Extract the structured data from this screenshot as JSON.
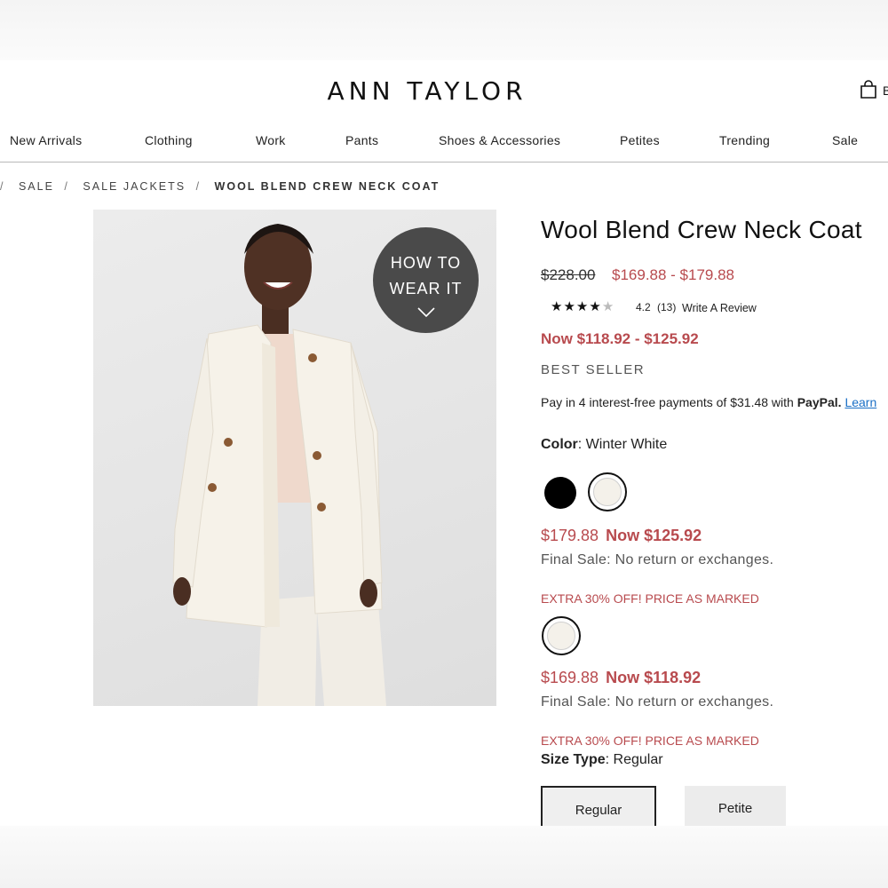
{
  "brand": {
    "logo_text": "ANN TAYLOR",
    "bag_label": "B"
  },
  "nav": {
    "items": [
      {
        "label": "New Arrivals"
      },
      {
        "label": "Clothing"
      },
      {
        "label": "Work"
      },
      {
        "label": "Pants"
      },
      {
        "label": "Shoes & Accessories"
      },
      {
        "label": "Petites"
      },
      {
        "label": "Trending"
      },
      {
        "label": "Sale"
      }
    ]
  },
  "breadcrumb": {
    "lead_sep": "/",
    "items": [
      "SALE",
      "SALE JACKETS"
    ],
    "sep": "/",
    "current": "WOOL BLEND CREW NECK COAT"
  },
  "image": {
    "badge_line1": "HOW TO",
    "badge_line2": "WEAR IT",
    "icon": "chevron-down-icon"
  },
  "product": {
    "title": "Wool Blend Crew Neck Coat",
    "original_price": "$228.00",
    "sale_range": "$169.88 - $179.88",
    "rating": "4.2",
    "rating_value": 4.2,
    "review_count": "(13)",
    "write_review": "Write A Review",
    "now_range": "Now $118.92 - $125.92",
    "badge": "BEST SELLER",
    "paypal": {
      "prefix": "Pay in 4 interest-free payments of $31.48 with ",
      "brand": "PayPal.",
      "link": "Learn"
    }
  },
  "color": {
    "label": "Color",
    "selected": "Winter White",
    "swatches": [
      {
        "name": "Black",
        "hex": "#000000",
        "selected": false
      },
      {
        "name": "Winter White",
        "hex": "#f4f1ea",
        "selected": true
      }
    ]
  },
  "offers": [
    {
      "was": "$179.88",
      "now": "Now $125.92",
      "final": "Final Sale: No return or exchanges.",
      "extra": "EXTRA 30% OFF! PRICE AS MARKED"
    },
    {
      "was": "$169.88",
      "now": "Now $118.92",
      "final": "Final Sale: No return or exchanges.",
      "extra": "EXTRA 30% OFF! PRICE AS MARKED"
    }
  ],
  "size": {
    "label": "Size Type",
    "selected": "Regular",
    "options": [
      {
        "label": "Regular",
        "selected": true
      },
      {
        "label": "Petite",
        "selected": false
      }
    ]
  },
  "colors": {
    "accent_red": "#b84a4e",
    "link_blue": "#1a6fc6",
    "badge_gray": "#4a4a4a"
  }
}
